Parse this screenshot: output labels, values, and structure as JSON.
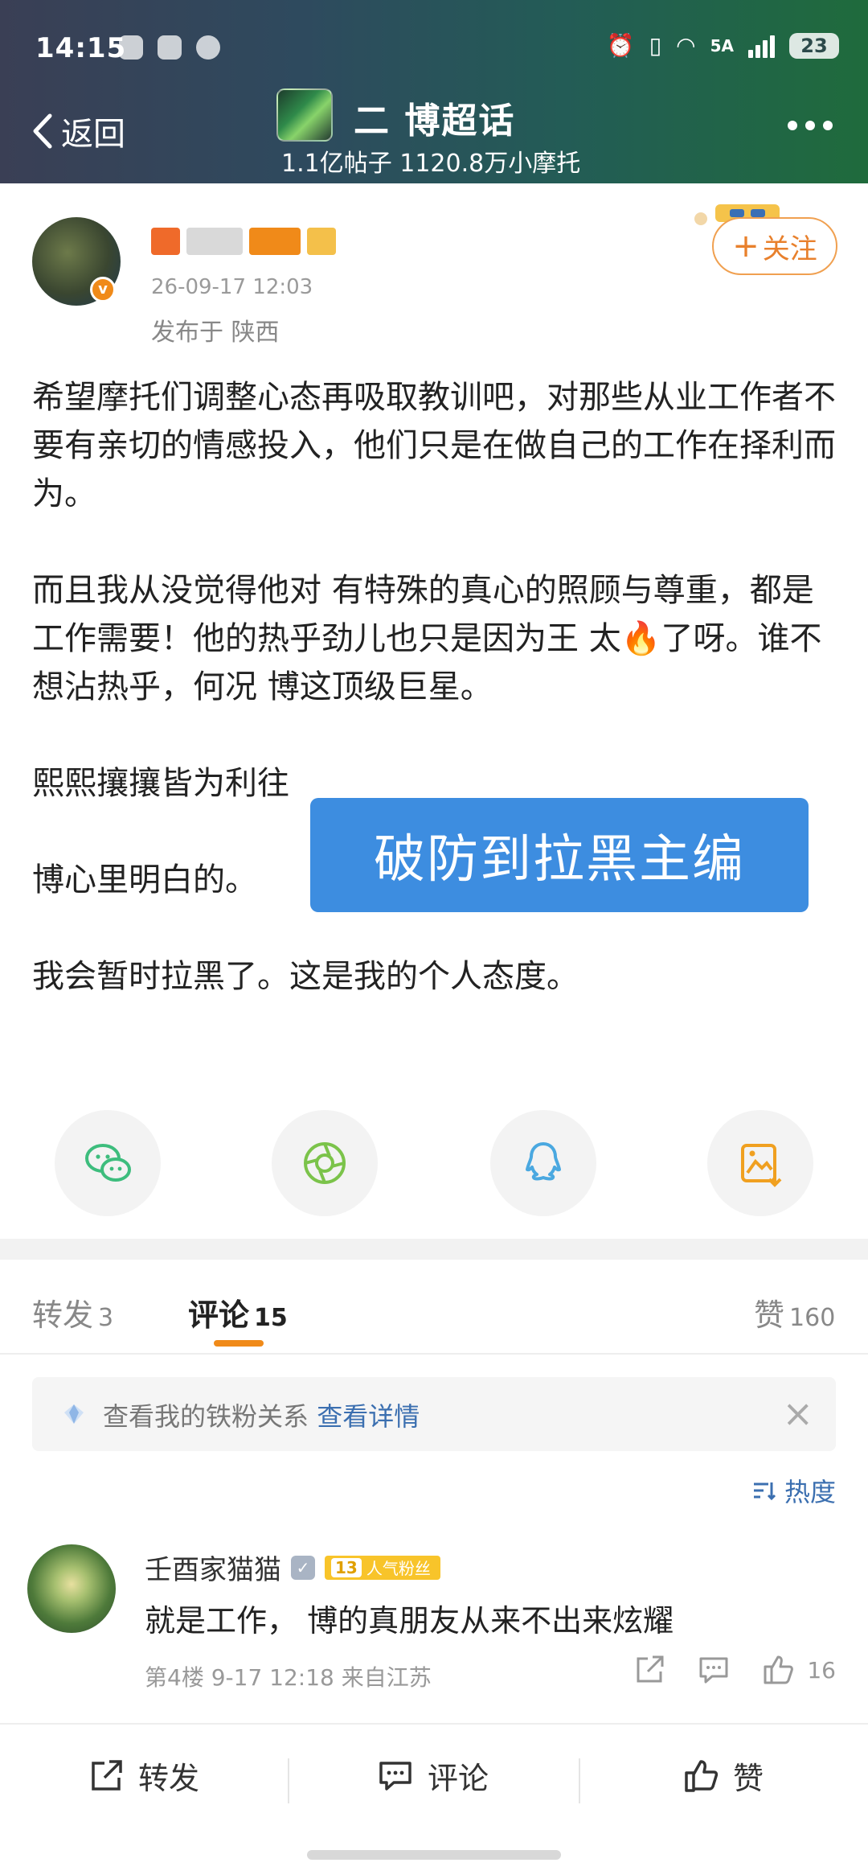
{
  "status_bar": {
    "time": "14:15",
    "network": "5A",
    "battery": "23"
  },
  "nav": {
    "back_label": "返回",
    "topic_title": "二 博超话",
    "topic_stats": "1.1亿帖子 1120.8万小摩托"
  },
  "post": {
    "author_name": "",
    "timestamp": "26-09-17 12:03",
    "location": "发布于 陕西",
    "follow_label": "关注",
    "paragraphs": [
      "希望摩托们调整心态再吸取教训吧，对那些从业工作者不要有亲切的情感投入，他们只是在做自己的工作在择利而为。",
      "而且我从没觉得他对 有特殊的真心的照顾与尊重，都是工作需要！他的热乎劲儿也只是因为王 太🔥了呀。谁不想沾热乎，何况 博这顶级巨星。",
      "熙熙攘攘皆为利往",
      "博心里明白的。",
      "我会暂时拉黑了。这是我的个人态度。"
    ],
    "overlay_caption": "破防到拉黑主编"
  },
  "share": {
    "icons": [
      "wechat-icon",
      "moments-icon",
      "qq-icon",
      "save-image-icon"
    ],
    "colors": [
      "#3dbd7d",
      "#7bc34a",
      "#4aa8e0",
      "#f0a020"
    ]
  },
  "tabs": [
    {
      "label": "转发",
      "count": "3"
    },
    {
      "label": "评论",
      "count": "15"
    },
    {
      "label": "赞",
      "count": "160"
    }
  ],
  "fan_banner": {
    "text": "查看我的铁粉关系",
    "link": "查看详情"
  },
  "sort_label": "热度",
  "comment": {
    "user": "壬酉家猫猫",
    "fan_level": "13",
    "fan_badge": "人气粉丝",
    "text": "就是工作， 博的真朋友从来不出来炫耀",
    "meta": "第4楼 9-17 12:18 来自江苏",
    "likes": "16"
  },
  "bottom_bar": {
    "repost": "转发",
    "comment": "评论",
    "like": "赞"
  },
  "colors": {
    "accent": "#f08a19",
    "link": "#3b6fb0",
    "overlay": "#3d8de0"
  }
}
